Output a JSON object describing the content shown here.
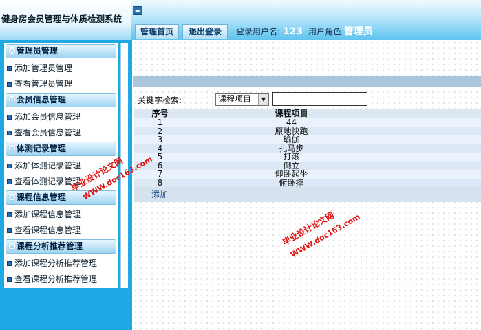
{
  "header": {
    "system_title": "健身房会员管理与体质检测系统",
    "toggle_glyph": "◂▸",
    "tabs": [
      {
        "label": "管理首页"
      },
      {
        "label": "退出登录"
      }
    ],
    "login": {
      "user_label": "登录用户名:",
      "user_value": "123",
      "role_label": "用户角色",
      "role_value": "管理员"
    }
  },
  "sidebar": {
    "groups": [
      {
        "title": "管理员管理",
        "items": [
          "添加管理员管理",
          "查看管理员管理"
        ]
      },
      {
        "title": "会员信息管理",
        "items": [
          "添加会员信息管理",
          "查看会员信息管理"
        ]
      },
      {
        "title": "体测记录管理",
        "items": [
          "添加体测记录管理",
          "查看体测记录管理"
        ]
      },
      {
        "title": "课程信息管理",
        "items": [
          "添加课程信息管理",
          "查看课程信息管理"
        ]
      },
      {
        "title": "课程分析推荐管理",
        "items": [
          "添加课程分析推荐管理",
          "查看课程分析推荐管理"
        ]
      }
    ]
  },
  "search": {
    "label": "关键字检索:",
    "selected_field": "课程项目",
    "value": ""
  },
  "table": {
    "headers": [
      "序号",
      "课程项目"
    ],
    "rows": [
      [
        "1",
        "44"
      ],
      [
        "2",
        "原地快跑"
      ],
      [
        "3",
        "瑜伽"
      ],
      [
        "4",
        "扎马步"
      ],
      [
        "5",
        "打滚"
      ],
      [
        "6",
        "倒立"
      ],
      [
        "7",
        "仰卧起坐"
      ],
      [
        "8",
        "俯卧撑"
      ]
    ],
    "add_label": "添加"
  },
  "watermarks": {
    "text_cn": "毕业设计论文网",
    "text_url": "WWW.doc163.com"
  },
  "colors": {
    "sidebar_frame": "#1ea8e4",
    "watermark": "#e01111",
    "group_header": "#9fd4f1"
  }
}
